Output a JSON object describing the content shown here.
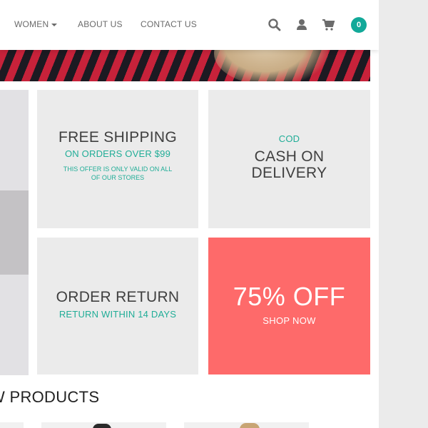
{
  "nav": {
    "women": "WOMEN",
    "about": "ABOUT US",
    "contact": "CONTACT US"
  },
  "header_icons": [
    "search-icon",
    "user-icon",
    "cart-icon"
  ],
  "cart": {
    "count": "0",
    "badge_color": "#12a999"
  },
  "promos": {
    "shipping": {
      "title": "FREE SHIPPING",
      "subtitle": "ON ORDERS OVER $99",
      "note": "THIS OFFER IS ONLY VALID ON ALL OF OUR STORES"
    },
    "cod": {
      "label": "COD",
      "title": "CASH ON DELIVERY"
    },
    "return": {
      "title": "ORDER RETURN",
      "subtitle": "RETURN WITHIN 14 DAYS"
    },
    "sale": {
      "title": "75% OFF",
      "cta": "SHOP NOW",
      "color": "#fe6a6a"
    }
  },
  "products": {
    "heading": "W PRODUCTS"
  },
  "colors": {
    "accent": "#20ad97",
    "tile_bg": "#ebebeb",
    "text": "#3f3f3f"
  }
}
